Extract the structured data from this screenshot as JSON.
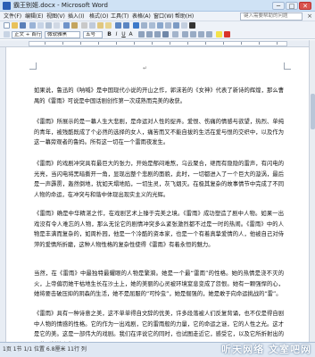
{
  "window": {
    "title": "霸王别姬.docx - Microsoft Word",
    "controls": [
      "─",
      "□",
      "✕"
    ]
  },
  "menubar": {
    "items": [
      "文件(F)",
      "编辑(E)",
      "视图(V)",
      "插入(I)",
      "格式(O)",
      "工具(T)",
      "表格(A)",
      "窗口(W)",
      "帮助(H)"
    ],
    "help_placeholder": "键入需要帮助的问题",
    "help_close": "×"
  },
  "toolbar": {
    "style_value": "正文 + 首行缩",
    "font_value": "微软雅黑",
    "size_value": "五号",
    "format_letters": [
      "B",
      "I",
      "U",
      "A"
    ]
  },
  "document": {
    "paragraphs": [
      "如果说，鲁迅的《呐喊》是中国现代小说的开山之作，郭沫若的《女神》代表了新诗的辉煌，那么曹禺的《雷雨》可说是中国话剧创作第一次成熟而完美的收获。",
      "《雷雨》所展示的是一幕人生大悲剧，是命运对人性的捉弄。爱恨、伤痛的情感与欲望，热烈、单纯的青年，被残酷既成了个必然的选择的女人，痛苦而又不能自拔的生活在爱与恨的交织中，以及作为这一幕旁观者的鲁妈。所有这一切在一个雷雨夜发生。",
      "《雷雨》的戏剧冲突具有最巨大的张力，开始是郁闷难熬，乌云聚合，继而有隐隐的雷声，有闪电的光亮，当闪电将黑暗撕开一角，显现出整个悲剧的面貌，此时，一切都进入了一个巨大的漩涡，最后是一声霹雳，轰然倒地，犹如天塌地陷，一切生灵，灰飞烟灭。在极其复杂的故事情节中完成了不同人物的命运，在冲突与和谐中体现出现实主义的光辉。",
      "《雷雨》确是中华精湛之作，在戏剧艺术上臻于完美之境。《雷雨》成功塑造了剧中人物。如果一出戏没有令人难忘的人物，那么无论它的剧情冲突多么紧张激烈都不过是一时的热闹。《雷雨》中的人物是丰满而复杂的，如周朴园，他是一个冷酷的资本家，也是一个有着真挚爱情的人，他被自己对侍萍的爱情所折磨，这种人物性格的复杂性使得《雷雨》有着永恒的魅力。",
      "当然，在《雷雨》中最独特最耀眼的人物是繁漪。她是一个最“雷雨”的性格。她的热情是浇不灭的火，上帝偏罚她干枯地生长在沙土上，她的美丽的心灵被环境窒息变成了怨恨。她有一颗强悍的心，她将要击破压抑的阴森的生活，她不是屈服的“可怜虫”，她是倔强的，她是敢于向命运挑战的“雷”。",
      "《雷雨》具有一种诗意之美，这不单单得自文辞的优美，许多段落被人们反复背诵，也不仅是得自剧中人物的情感的性格。它的作为一出戏剧，它的雷雨般的力量，它的命运之谜，它的人性之光。这才是它的美。这是一部伟大的戏剧。我们在评说它的同时，也试图走近它，感受它，以及它所折射出的一种别样的人生。"
    ]
  },
  "statusbar": {
    "text": "1页 1节 1/1 位置 6.8厘米 11行 列",
    "watermark": "听天网络  文室吧网"
  }
}
